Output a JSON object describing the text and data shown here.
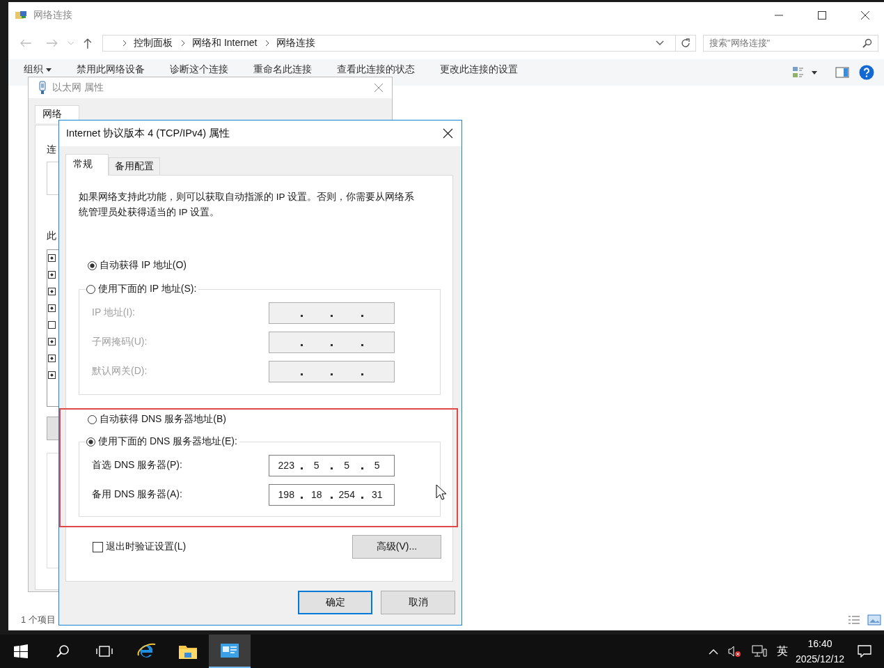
{
  "explorer": {
    "title": "网络连接",
    "breadcrumb": [
      "控制面板",
      "网络和 Internet",
      "网络连接"
    ],
    "search": {
      "placeholder": "搜索\"网络连接\""
    },
    "toolbar": [
      "组织",
      "禁用此网络设备",
      "诊断这个连接",
      "重命名此连接",
      "查看此连接的状态",
      "更改此连接的设置"
    ],
    "status": "1 个项目"
  },
  "ethernet_dialog": {
    "title": "以太网 属性",
    "tab": "网络",
    "labels": [
      "连",
      "此"
    ],
    "components": [
      {
        "checked": true
      },
      {
        "checked": true
      },
      {
        "checked": true
      },
      {
        "checked": true
      },
      {
        "checked": false
      },
      {
        "checked": true
      },
      {
        "checked": true
      },
      {
        "checked": true
      }
    ]
  },
  "ipv4_dialog": {
    "title": "Internet 协议版本 4 (TCP/IPv4) 属性",
    "tabs": [
      {
        "label": "常规",
        "selected": true
      },
      {
        "label": "备用配置",
        "selected": false
      }
    ],
    "description": "如果网络支持此功能，则可以获取自动指派的 IP 设置。否则，你需要从网络系统管理员处获得适当的 IP 设置。",
    "ip_options": [
      {
        "label": "自动获得 IP 地址(O)",
        "selected": true
      },
      {
        "label": "使用下面的 IP 地址(S):",
        "selected": false
      }
    ],
    "ip_fields": [
      {
        "label": "IP 地址(I):",
        "disabled": true
      },
      {
        "label": "子网掩码(U):",
        "disabled": true
      },
      {
        "label": "默认网关(D):",
        "disabled": true
      }
    ],
    "dns_options": [
      {
        "label": "自动获得 DNS 服务器地址(B)",
        "selected": false
      },
      {
        "label": "使用下面的 DNS 服务器地址(E):",
        "selected": true
      }
    ],
    "dns_fields": [
      {
        "label": "首选 DNS 服务器(P):",
        "disabled": false,
        "octets": [
          "223",
          "5",
          "5",
          "5"
        ]
      },
      {
        "label": "备用 DNS 服务器(A):",
        "disabled": false,
        "octets": [
          "198",
          "18",
          "254",
          "31"
        ]
      }
    ],
    "validate": {
      "label": "退出时验证设置(L)",
      "checked": false
    },
    "advanced_button": "高级(V)...",
    "buttons": [
      "确定",
      "取消"
    ]
  },
  "taskbar": {
    "apps": [
      {
        "kind": "browser",
        "selected": false
      },
      {
        "kind": "folder",
        "selected": false
      },
      {
        "kind": "network",
        "selected": true
      }
    ],
    "input_method": "英",
    "time": "16:40",
    "date": "2025/12/12"
  }
}
